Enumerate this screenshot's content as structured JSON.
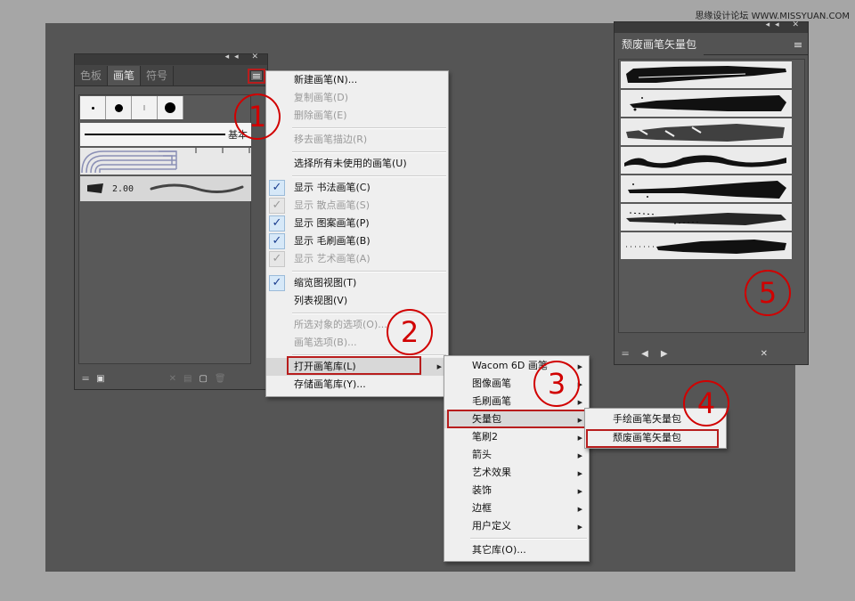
{
  "watermark": "思缘设计论坛 WWW.MISSYUAN.COM",
  "brushes_panel": {
    "tabs": [
      "色板",
      "画笔",
      "符号"
    ],
    "active_tab": "画笔",
    "basic_label": "基本",
    "bristle_size": "2.00"
  },
  "context_menu": {
    "items": [
      {
        "label": "新建画笔(N)...",
        "enabled": true
      },
      {
        "label": "复制画笔(D)",
        "enabled": false
      },
      {
        "label": "删除画笔(E)",
        "enabled": false
      },
      {
        "label": "移去画笔描边(R)",
        "enabled": false
      },
      {
        "label": "选择所有未使用的画笔(U)",
        "enabled": true
      },
      {
        "label": "显示 书法画笔(C)",
        "enabled": true,
        "checked": true
      },
      {
        "label": "显示 散点画笔(S)",
        "enabled": false,
        "checked": true
      },
      {
        "label": "显示 图案画笔(P)",
        "enabled": true,
        "checked": true
      },
      {
        "label": "显示 毛刷画笔(B)",
        "enabled": true,
        "checked": true
      },
      {
        "label": "显示 艺术画笔(A)",
        "enabled": false,
        "checked": true
      },
      {
        "label": "缩览图视图(T)",
        "enabled": true,
        "checked": true
      },
      {
        "label": "列表视图(V)",
        "enabled": true
      },
      {
        "label": "所选对象的选项(O)...",
        "enabled": false
      },
      {
        "label": "画笔选项(B)...",
        "enabled": false
      },
      {
        "label": "打开画笔库(L)",
        "enabled": true,
        "submenu": true
      },
      {
        "label": "存储画笔库(Y)...",
        "enabled": true
      }
    ]
  },
  "library_menu": {
    "items": [
      "Wacom 6D 画笔",
      "图像画笔",
      "毛刷画笔",
      "矢量包",
      "笔刷2",
      "箭头",
      "艺术效果",
      "装饰",
      "边框",
      "用户定义",
      "其它库(O)..."
    ]
  },
  "vector_pack_menu": {
    "items": [
      "手绘画笔矢量包",
      "颓废画笔矢量包"
    ]
  },
  "vector_panel": {
    "title": "颓废画笔矢量包"
  },
  "annotations": [
    "1",
    "2",
    "3",
    "4",
    "5"
  ],
  "colors": {
    "annotation_red": "#d10000",
    "checkbox_blue": "#1a3d8f",
    "workspace_gray": "#555555"
  },
  "icons": [
    "brush-library-icon",
    "arrow-left-icon",
    "arrow-right-icon",
    "delete-icon",
    "panel-menu-icon"
  ]
}
